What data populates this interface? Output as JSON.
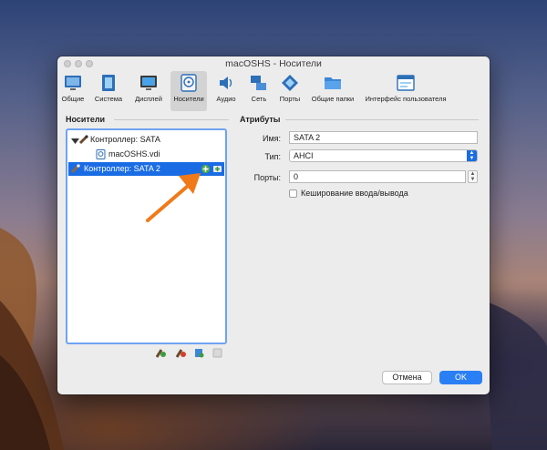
{
  "window": {
    "title": "macOSHS - Носители"
  },
  "toolbar": {
    "items": [
      {
        "label": "Общие",
        "icon": "general-icon"
      },
      {
        "label": "Система",
        "icon": "system-icon"
      },
      {
        "label": "Дисплей",
        "icon": "display-icon"
      },
      {
        "label": "Носители",
        "icon": "storage-icon",
        "active": true
      },
      {
        "label": "Аудио",
        "icon": "audio-icon"
      },
      {
        "label": "Сеть",
        "icon": "network-icon"
      },
      {
        "label": "Порты",
        "icon": "ports-icon"
      },
      {
        "label": "Общие папки",
        "icon": "shared-folders-icon"
      },
      {
        "label": "Интерфейс пользователя",
        "icon": "user-interface-icon"
      }
    ]
  },
  "storage": {
    "header": "Носители",
    "tree": [
      {
        "label": "Контроллер: SATA",
        "icon": "controller-icon"
      },
      {
        "label": "macOSHS.vdi",
        "icon": "disk-image-icon"
      },
      {
        "label": "Контроллер: SATA 2",
        "icon": "controller-icon",
        "selected": true
      }
    ],
    "tree_buttons": [
      "add-controller-icon",
      "remove-controller-icon",
      "add-attachment-icon",
      "remove-attachment-icon"
    ]
  },
  "attributes": {
    "header": "Атрибуты",
    "name_label": "Имя:",
    "name_value": "SATA 2",
    "type_label": "Тип:",
    "type_value": "AHCI",
    "ports_label": "Порты:",
    "ports_value": "0",
    "cache_label": "Кеширование ввода/вывода",
    "cache_checked": false
  },
  "footer": {
    "cancel_label": "Отмена",
    "ok_label": "OK"
  },
  "colors": {
    "accent": "#1a6ce4",
    "annotation_arrow": "#f07a1a"
  }
}
